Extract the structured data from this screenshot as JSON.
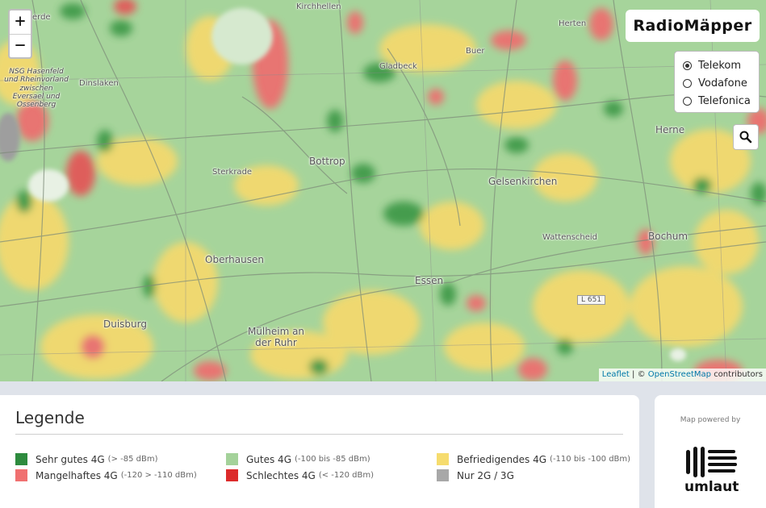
{
  "brand": {
    "name": "RadioMäpper"
  },
  "zoom": {
    "in_label": "+",
    "out_label": "−"
  },
  "networks": {
    "options": [
      {
        "label": "Telekom",
        "selected": true
      },
      {
        "label": "Vodafone",
        "selected": false
      },
      {
        "label": "Telefonica",
        "selected": false
      }
    ]
  },
  "search": {
    "icon": "magnifier-icon"
  },
  "attribution": {
    "leaflet": "Leaflet",
    "separator": "| ©",
    "osm": "OpenStreetMap",
    "contributors": "contributors"
  },
  "map": {
    "places": {
      "kirchhellen": "Kirchhellen",
      "herten": "Herten",
      "gladbeck": "Gladbeck",
      "buer": "Buer",
      "dinslaken": "Dinslaken",
      "nsg": "NSG Hasenfeld und Rheinvorland zwischen Eversael und Ossenberg",
      "herne": "Herne",
      "bottrop": "Bottrop",
      "sterkrade": "Sterkrade",
      "gelsenkirchen": "Gelsenkirchen",
      "wattenscheid": "Wattenscheid",
      "bochum": "Bochum",
      "oberhausen": "Oberhausen",
      "essen": "Essen",
      "duisburg": "Duisburg",
      "mulheim": "Mülheim an der Ruhr",
      "l651": "L 651",
      "erde": "erde"
    },
    "colors": {
      "very_good": "#2e8b3e",
      "good": "#a4d29a",
      "satisfactory": "#f6dc6e",
      "deficient": "#f07070",
      "bad": "#dc2b2b",
      "only_2g3g": "#a8a8a8"
    }
  },
  "legend": {
    "title": "Legende",
    "items": [
      {
        "label": "Sehr gutes 4G",
        "range": "(> -85 dBm)",
        "color": "#2e8b3e"
      },
      {
        "label": "Gutes 4G",
        "range": "(-100 bis -85 dBm)",
        "color": "#a4d29a"
      },
      {
        "label": "Befriedigendes 4G",
        "range": "(-110 bis -100 dBm)",
        "color": "#f6dc6e"
      },
      {
        "label": "Mangelhaftes 4G",
        "range": "(-120 > -110 dBm)",
        "color": "#f07070"
      },
      {
        "label": "Schlechtes 4G",
        "range": "(< -120 dBm)",
        "color": "#dc2b2b"
      },
      {
        "label": "Nur 2G / 3G",
        "range": "",
        "color": "#a8a8a8"
      }
    ]
  },
  "powered": {
    "caption": "Map powered by",
    "logo_text": "umlaut"
  }
}
